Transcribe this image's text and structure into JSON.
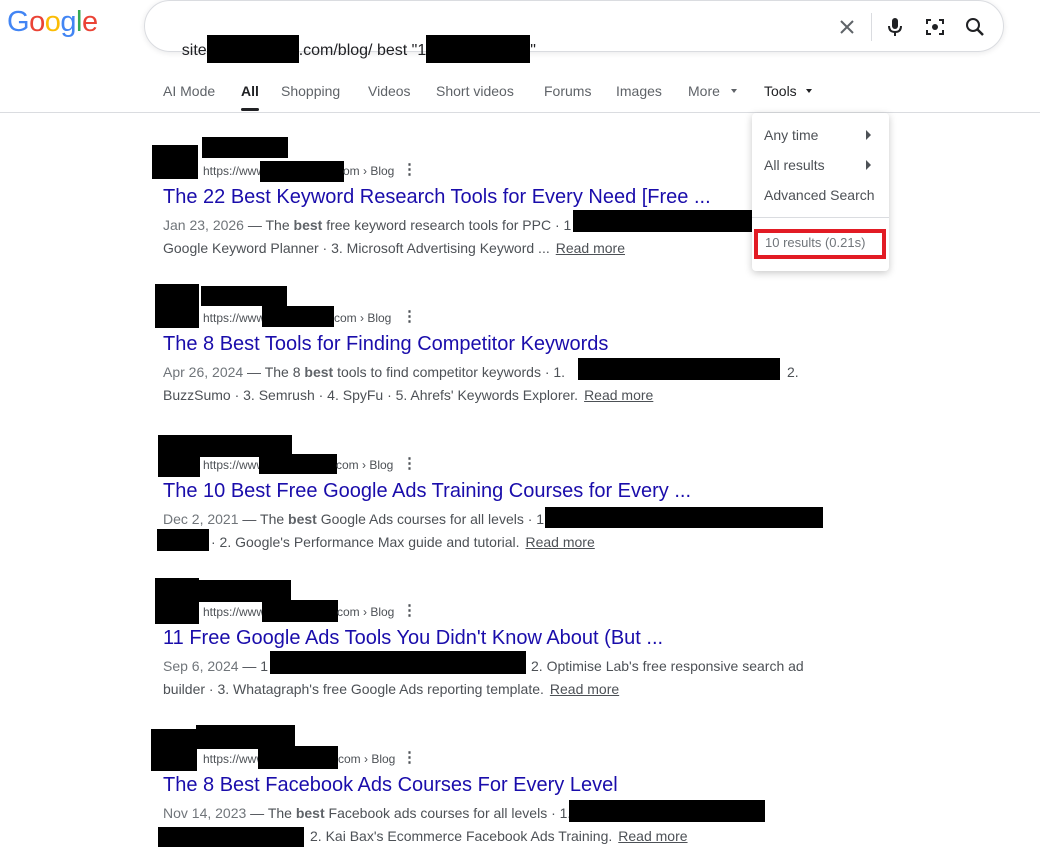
{
  "logo": {
    "letters": [
      "G",
      "o",
      "o",
      "g",
      "l",
      "e"
    ],
    "colors": [
      "#4285f4",
      "#ea4335",
      "#fbbc05",
      "#4285f4",
      "#34a853",
      "#ea4335"
    ]
  },
  "search": {
    "query_prefix": "site",
    "query_middle": ".com/blog/ best \"1",
    "query_suffix": "\"",
    "icons": [
      "close-icon",
      "mic-icon",
      "lens-icon",
      "search-icon"
    ]
  },
  "tabs": [
    {
      "label": "AI Mode"
    },
    {
      "label": "All",
      "active": true
    },
    {
      "label": "Shopping"
    },
    {
      "label": "Videos"
    },
    {
      "label": "Short videos"
    },
    {
      "label": "Forums"
    },
    {
      "label": "Images"
    },
    {
      "label": "More"
    },
    {
      "label": "Tools"
    }
  ],
  "tools_menu": {
    "items": [
      {
        "label": "Any time"
      },
      {
        "label": "All results"
      },
      {
        "label": "Advanced Search"
      }
    ],
    "results_count": "10 results (0.21s)"
  },
  "results": [
    {
      "url_prefix": "https://www",
      "crumb": "om › Blog",
      "title": "The 22 Best Keyword Research Tools for Every Need [Free ...",
      "date": "Jan 23, 2026",
      "snippet_pre": " — The ",
      "snippet_bold": "best",
      "snippet_post": " free keyword research tools for PPC · 1",
      "line2": "Google Keyword Planner · 3. Microsoft Advertising Keyword ...",
      "read_more": "Read more"
    },
    {
      "url_prefix": "https://www",
      "crumb": "com › Blog",
      "title": "The 8 Best Tools for Finding Competitor Keywords",
      "date": "Apr 26, 2024",
      "snippet_pre": " — The 8 ",
      "snippet_bold": "best",
      "snippet_post": " tools to find competitor keywords · 1.",
      "snippet_tail": "2.",
      "line2": "BuzzSumo · 3. Semrush · 4. SpyFu · 5. Ahrefs' Keywords Explorer.",
      "read_more": "Read more"
    },
    {
      "url_prefix": "https://www",
      "crumb": "com › Blog",
      "title": "The 10 Best Free Google Ads Training Courses for Every ...",
      "date": "Dec 2, 2021",
      "snippet_pre": " — The ",
      "snippet_bold": "best",
      "snippet_post": " Google Ads courses for all levels · 1",
      "line2": "· 2. Google's Performance Max guide and tutorial.",
      "read_more": "Read more"
    },
    {
      "url_prefix": "https://www",
      "crumb": "com › Blog",
      "title": "11 Free Google Ads Tools You Didn't Know About (But ...",
      "date": "Sep 6, 2024",
      "snippet_pre": " — 1",
      "snippet_bold": "",
      "snippet_post": "",
      "snippet_tail": "2. Optimise Lab's free responsive search ad",
      "line2": "builder · 3. Whatagraph's free Google Ads reporting template.",
      "read_more": "Read more"
    },
    {
      "url_prefix": "https://www",
      "crumb": "com › Blog",
      "title": "The 8 Best Facebook Ads Courses For Every Level",
      "date": "Nov 14, 2023",
      "snippet_pre": " — The ",
      "snippet_bold": "best",
      "snippet_post": " Facebook ads courses for all levels · 1.",
      "line2": "2. Kai Bax's Ecommerce Facebook Ads Training.",
      "read_more": "Read more"
    }
  ]
}
